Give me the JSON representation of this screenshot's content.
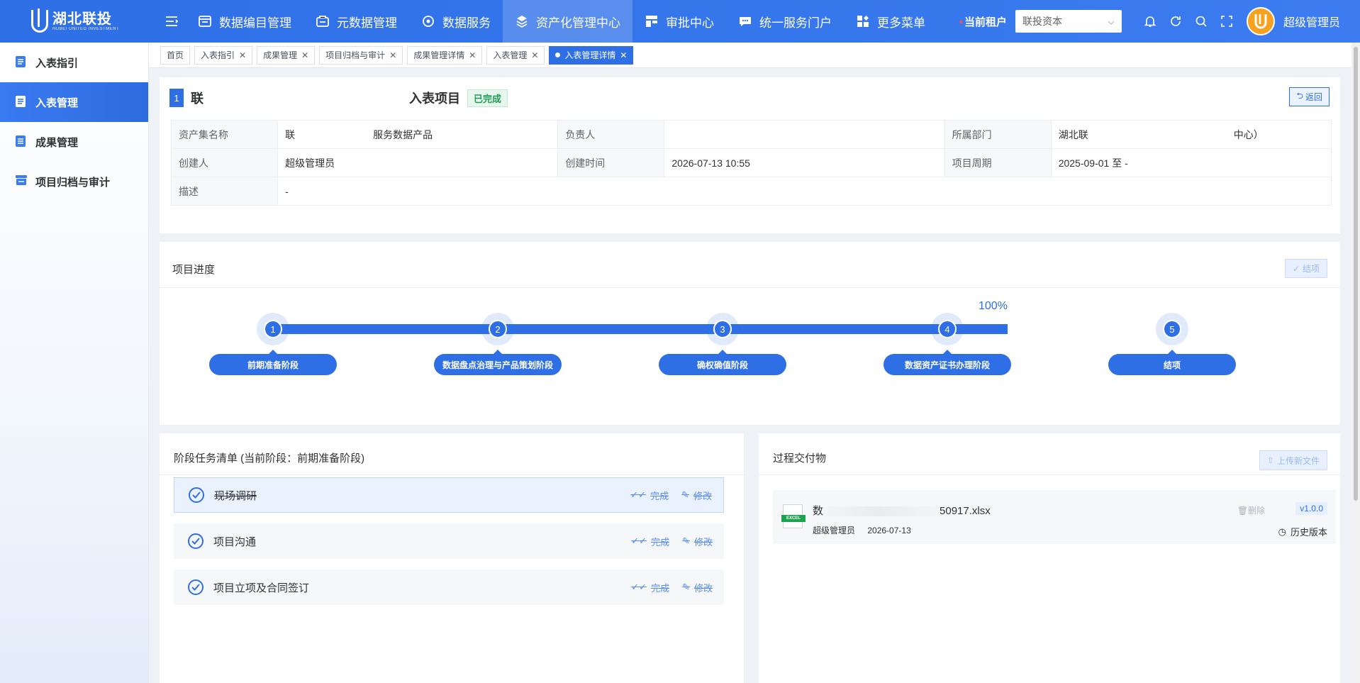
{
  "header": {
    "logo_cn": "湖北联投",
    "logo_en": "HUBEI UNITED INVESTMENT",
    "nav": [
      {
        "label": "数据编目管理",
        "icon": "catalog-icon"
      },
      {
        "label": "元数据管理",
        "icon": "metadata-icon"
      },
      {
        "label": "数据服务",
        "icon": "service-icon"
      },
      {
        "label": "资产化管理中心",
        "icon": "cube-icon"
      },
      {
        "label": "审批中心",
        "icon": "approval-icon"
      },
      {
        "label": "统一服务门户",
        "icon": "chat-icon"
      },
      {
        "label": "更多菜单",
        "icon": "grid-icon"
      }
    ],
    "active_nav": "资产化管理中心",
    "tenant_label": "当前租户",
    "tenant_value": "联投资本",
    "user_name": "超级管理员"
  },
  "sidebar": {
    "items": [
      {
        "label": "入表指引"
      },
      {
        "label": "入表管理"
      },
      {
        "label": "成果管理"
      },
      {
        "label": "项目归档与审计"
      }
    ],
    "active": "入表管理"
  },
  "tabs": [
    {
      "label": "首页",
      "closable": false
    },
    {
      "label": "入表指引",
      "closable": true
    },
    {
      "label": "成果管理",
      "closable": true
    },
    {
      "label": "项目归档与审计",
      "closable": true
    },
    {
      "label": "成果管理详情",
      "closable": true
    },
    {
      "label": "入表管理",
      "closable": true
    },
    {
      "label": "入表管理详情",
      "closable": true,
      "active": true
    }
  ],
  "project": {
    "number": "1",
    "title_start": "联",
    "title_end": "入表项目",
    "status": "已完成",
    "back_label": "返回",
    "fields": {
      "asset_set_label": "资产集名称",
      "asset_set_value_start": "联",
      "asset_set_value_end": "服务数据产品",
      "owner_label": "负责人",
      "owner_value": "",
      "dept_label": "所属部门",
      "dept_value_start": "湖北联",
      "dept_value_end": "中心）",
      "creator_label": "创建人",
      "creator_value": "超级管理员",
      "created_label": "创建时间",
      "created_value": "2026-07-13 10:55",
      "period_label": "项目周期",
      "period_value": "2025-09-01 至 -",
      "desc_label": "描述",
      "desc_value": "-"
    }
  },
  "progress": {
    "title": "项目进度",
    "close_label": "结项",
    "percent": "100%",
    "percent_value": 100,
    "steps": [
      {
        "num": "1",
        "label": "前期准备阶段"
      },
      {
        "num": "2",
        "label": "数据盘点治理与产品策划阶段"
      },
      {
        "num": "3",
        "label": "确权确值阶段"
      },
      {
        "num": "4",
        "label": "数据资产证书办理阶段"
      },
      {
        "num": "5",
        "label": "结项"
      }
    ]
  },
  "tasks": {
    "title": "阶段任务清单 (当前阶段：前期准备阶段)",
    "complete_label": "完成",
    "edit_label": "修改",
    "items": [
      {
        "name": "现场调研"
      },
      {
        "name": "项目沟通"
      },
      {
        "name": "项目立项及合同签订"
      }
    ]
  },
  "deliverables": {
    "title": "过程交付物",
    "upload_label": "上传新文件",
    "file": {
      "name_prefix": "数",
      "name_suffix": "50917.xlsx",
      "uploader": "超级管理员",
      "date": "2026-07-13",
      "delete_label": "删除",
      "version": "v1.0.0",
      "history_label": "历史版本",
      "icon_text": "EXCEL"
    }
  },
  "colors": {
    "primary": "#2f6fe6",
    "success": "#1f9d55"
  }
}
